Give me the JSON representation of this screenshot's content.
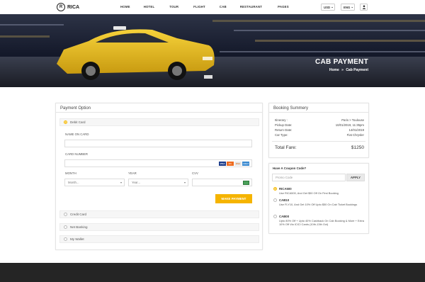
{
  "brand": {
    "name": "RICA",
    "mark": "R"
  },
  "nav": {
    "items": [
      "HOME",
      "HOTEL",
      "TOUR",
      "FLIGHT",
      "CAB",
      "RESTAURANT",
      "PAGES"
    ]
  },
  "currency": {
    "value": "USD",
    "caret": "⌄"
  },
  "language": {
    "value": "ENG",
    "caret": "⌄"
  },
  "user_icon": "user-icon",
  "hero": {
    "title": "CAB PAYMENT",
    "breadcrumb_home": "Home",
    "breadcrumb_sep": "»",
    "breadcrumb_current": "Cab Payment"
  },
  "payment": {
    "title": "Payment Option",
    "options": [
      "Debit Card",
      "Credit Card",
      "Net Banking",
      "My Wallet"
    ],
    "name_label": "NAME ON CARD",
    "card_label": "CARD NUMBER",
    "card_brands": [
      "VISA",
      "MC",
      "DSC",
      "AMEX"
    ],
    "month_label": "MONTH",
    "month_placeholder": "Month...",
    "year_label": "YEAR",
    "year_placeholder": "Year...",
    "cvv_label": "CVV",
    "submit": "MAKE PAYMENT"
  },
  "booking": {
    "title": "Booking Summery",
    "rows": [
      {
        "label": "Itinerary :",
        "value": "Paris > Toulouse"
      },
      {
        "label": "Pickup Date:",
        "value": "10/01/2019, 11:35pm"
      },
      {
        "label": "Return Date:",
        "value": "14/01/2019"
      },
      {
        "label": "Car Type:",
        "value": "Fiat Chrysler"
      }
    ],
    "total_label": "Total Fare:",
    "total_value": "$1250"
  },
  "coupon": {
    "title": "Have A Coupon Code?",
    "placeholder": "Promo Code",
    "apply": "APPLY",
    "codes": [
      {
        "code": "RICA500",
        "desc": "Use RICA500, And Get $50 Off On First Booking"
      },
      {
        "code": "CAB10",
        "desc": "Use FLY10, And Get 10% Off Upto $50 On Cab Ticket Bookings"
      },
      {
        "code": "CAB00",
        "desc": "Upto 80% Off + Upto 40% Cashback On Cab Booking & More + Extra 10% Off Via ICICI Cards (10th-13th Oct)"
      }
    ]
  },
  "colors": {
    "accent": "#f5b400",
    "footer": "#252525"
  }
}
